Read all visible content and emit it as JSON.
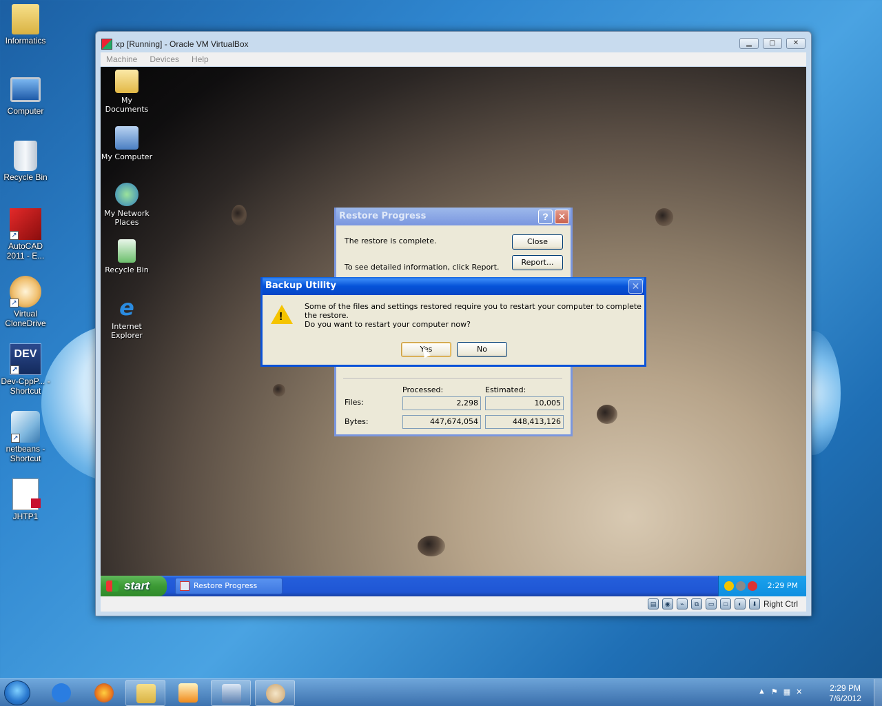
{
  "desktop": {
    "icons": [
      {
        "label": "Informatics",
        "icon": "folder-icon"
      },
      {
        "label": "Computer",
        "icon": "computer-icon"
      },
      {
        "label": "Recycle Bin",
        "icon": "recycle-bin-icon"
      },
      {
        "label": "AutoCAD 2011 - E...",
        "icon": "autocad-icon"
      },
      {
        "label": "Virtual CloneDrive",
        "icon": "clonedrive-icon"
      },
      {
        "label": "Dev-CppP... - Shortcut",
        "icon": "devcpp-icon",
        "badge": "DEV"
      },
      {
        "label": "netbeans - Shortcut",
        "icon": "netbeans-icon"
      },
      {
        "label": "JHTP1",
        "icon": "pdf-icon"
      }
    ]
  },
  "vbox": {
    "title": "xp [Running] - Oracle VM VirtualBox",
    "menu": [
      "Machine",
      "Devices",
      "Help"
    ],
    "status_host_key": "Right Ctrl"
  },
  "guest": {
    "icons": [
      {
        "label": "My Documents"
      },
      {
        "label": "My Computer"
      },
      {
        "label": "My Network Places"
      },
      {
        "label": "Recycle Bin"
      },
      {
        "label": "Internet Explorer"
      }
    ],
    "taskbar": {
      "start_label": "start",
      "task_label": "Restore Progress",
      "clock": "2:29 PM"
    }
  },
  "restore_dialog": {
    "title": "Restore Progress",
    "help_glyph": "?",
    "close_glyph": "✕",
    "message": "The restore is complete.",
    "report_hint": "To see detailed information, click Report.",
    "close_button": "Close",
    "report_button": "Report...",
    "processed_header": "Processed:",
    "estimated_header": "Estimated:",
    "files_label": "Files:",
    "bytes_label": "Bytes:",
    "files_processed": "2,298",
    "files_estimated": "10,005",
    "bytes_processed": "447,674,054",
    "bytes_estimated": "448,413,126"
  },
  "backup_dialog": {
    "title": "Backup Utility",
    "close_glyph": "✕",
    "warning_glyph": "!",
    "message": "Some of the files and settings restored require you to restart your computer to complete the restore.",
    "question": "Do you want to restart your computer now?",
    "yes_button": "Yes",
    "no_button": "No"
  },
  "win7_taskbar": {
    "clock_time": "2:29 PM",
    "clock_date": "7/6/2012",
    "buttons": [
      {
        "name": "internet-explorer",
        "color": "#2a7de1"
      },
      {
        "name": "firefox",
        "color": "#e8731c"
      },
      {
        "name": "windows-explorer",
        "color": "#e7c35a"
      },
      {
        "name": "media-player",
        "color": "#f08a1a"
      },
      {
        "name": "virtualbox",
        "color": "#5b7fb0"
      },
      {
        "name": "paint",
        "color": "#c9a06a"
      }
    ]
  },
  "colors": {
    "xp_title_blue": "#0a52d8",
    "xp_face": "#ece9d8",
    "xp_taskbar": "#245edb",
    "xp_start_green": "#3c9a35"
  }
}
